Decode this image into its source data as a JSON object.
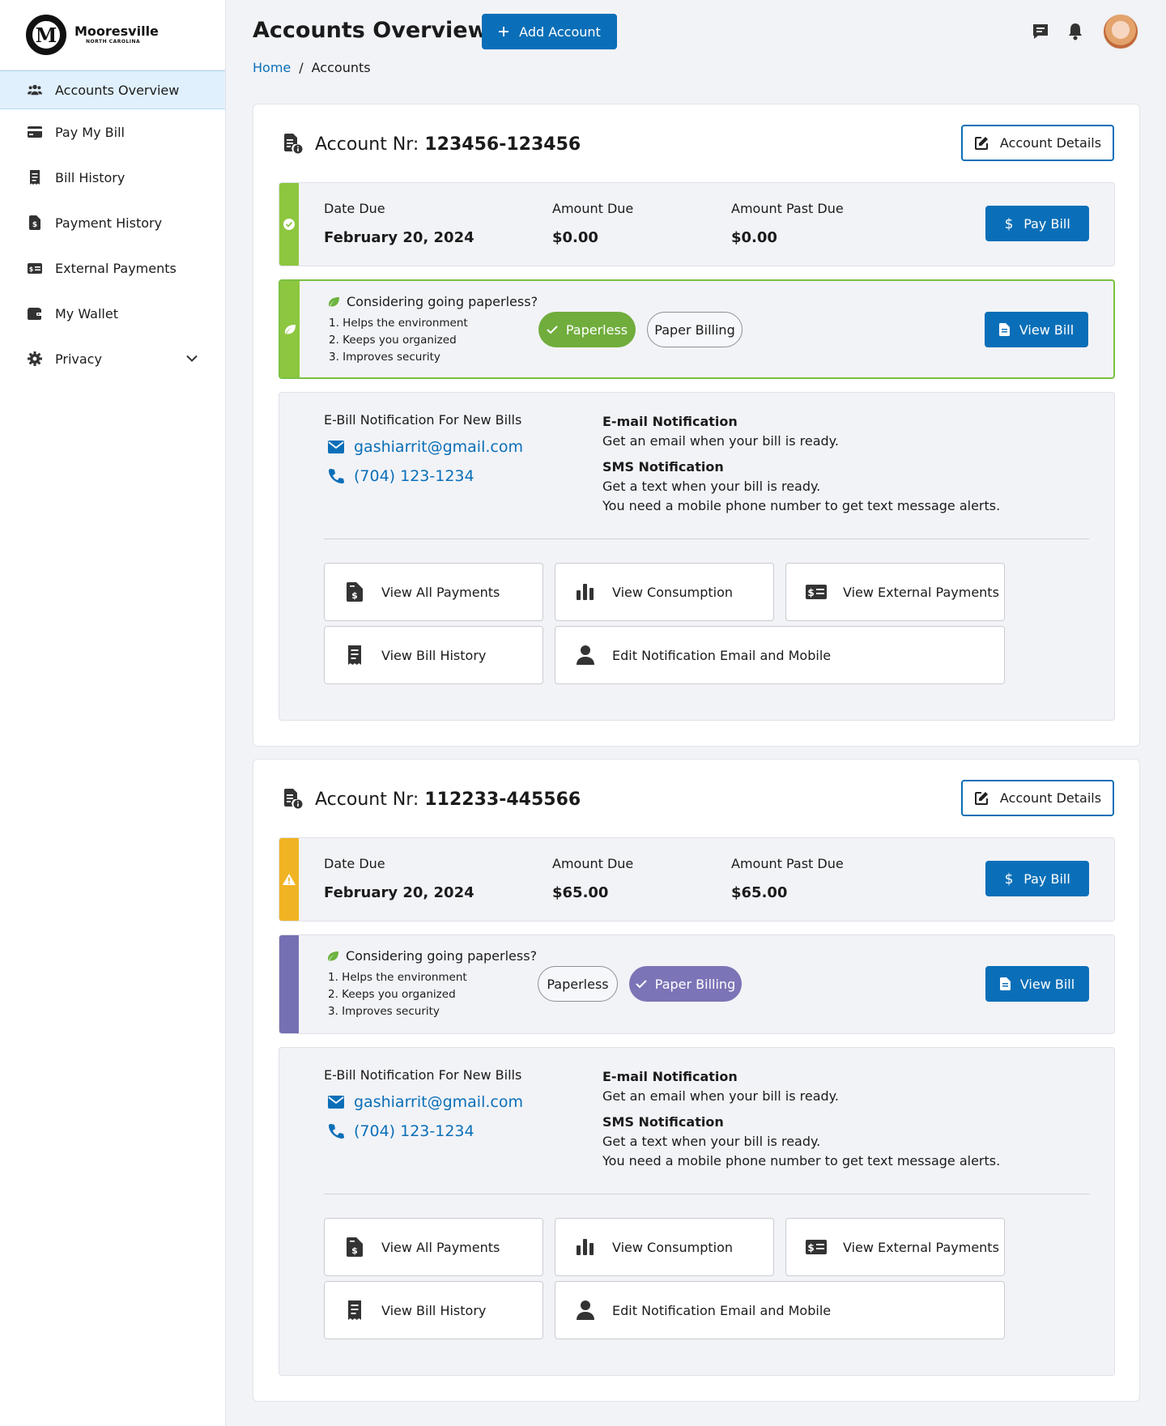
{
  "brand": {
    "name": "Mooresville",
    "sub": "NORTH CAROLINA",
    "seal_letter": "M"
  },
  "sidebar": {
    "items": [
      {
        "label": "Accounts Overview",
        "icon": "users-icon",
        "active": true
      },
      {
        "label": "Pay My Bill",
        "icon": "credit-card-icon"
      },
      {
        "label": "Bill History",
        "icon": "receipt-icon"
      },
      {
        "label": "Payment History",
        "icon": "invoice-dollar-icon"
      },
      {
        "label": "External Payments",
        "icon": "money-check-icon"
      },
      {
        "label": "My Wallet",
        "icon": "wallet-icon"
      },
      {
        "label": "Privacy",
        "icon": "gear-icon",
        "expandable": true
      }
    ]
  },
  "header": {
    "title": "Accounts Overview",
    "add_account_label": "Add Account",
    "breadcrumb": {
      "home": "Home",
      "separator": "/",
      "current": "Accounts"
    }
  },
  "colors": {
    "primary": "#0a6fb8",
    "ok_green": "#8dc63f",
    "warning_yellow": "#f0b323",
    "paper_purple": "#7570b3",
    "leaf_green": "#6cb33f"
  },
  "accounts": [
    {
      "label": "Account Nr:",
      "number": "123456-123456",
      "details_label": "Account Details",
      "status": "ok",
      "due": {
        "date_label": "Date Due",
        "date": "February 20, 2024",
        "amount_label": "Amount Due",
        "amount": "$0.00",
        "past_label": "Amount Past Due",
        "past": "$0.00",
        "pay_label": "Pay Bill"
      },
      "paperless": {
        "title": "Considering going paperless?",
        "benefits": [
          "1. Helps the environment",
          "2. Keeps you organized",
          "3. Improves security"
        ],
        "option_paperless": "Paperless",
        "option_paper": "Paper Billing",
        "selected": "paperless",
        "view_bill_label": "View Bill"
      },
      "notifications": {
        "title": "E-Bill Notification For New Bills",
        "email": "gashiarrit@gmail.com",
        "phone": "(704) 123-1234",
        "email_heading": "E-mail Notification",
        "email_desc": "Get an email when your bill is ready.",
        "sms_heading": "SMS Notification",
        "sms_desc": "Get a text when your bill is ready.",
        "sms_note": "You need a mobile phone number to get text message alerts."
      },
      "actions": [
        "View All Payments",
        "View Consumption",
        "View External Payments",
        "View Bill History",
        "Edit Notification Email and Mobile"
      ]
    },
    {
      "label": "Account Nr:",
      "number": "112233-445566",
      "details_label": "Account Details",
      "status": "warning",
      "due": {
        "date_label": "Date Due",
        "date": "February 20, 2024",
        "amount_label": "Amount Due",
        "amount": "$65.00",
        "past_label": "Amount Past Due",
        "past": "$65.00",
        "pay_label": "Pay Bill"
      },
      "paperless": {
        "title": "Considering going paperless?",
        "benefits": [
          "1. Helps the environment",
          "2. Keeps you organized",
          "3. Improves security"
        ],
        "option_paperless": "Paperless",
        "option_paper": "Paper Billing",
        "selected": "paper",
        "view_bill_label": "View Bill"
      },
      "notifications": {
        "title": "E-Bill Notification For New Bills",
        "email": "gashiarrit@gmail.com",
        "phone": "(704) 123-1234",
        "email_heading": "E-mail Notification",
        "email_desc": "Get an email when your bill is ready.",
        "sms_heading": "SMS Notification",
        "sms_desc": "Get a text when your bill is ready.",
        "sms_note": "You need a mobile phone number to get text message alerts."
      },
      "actions": [
        "View All Payments",
        "View Consumption",
        "View External Payments",
        "View Bill History",
        "Edit Notification Email and Mobile"
      ]
    }
  ]
}
